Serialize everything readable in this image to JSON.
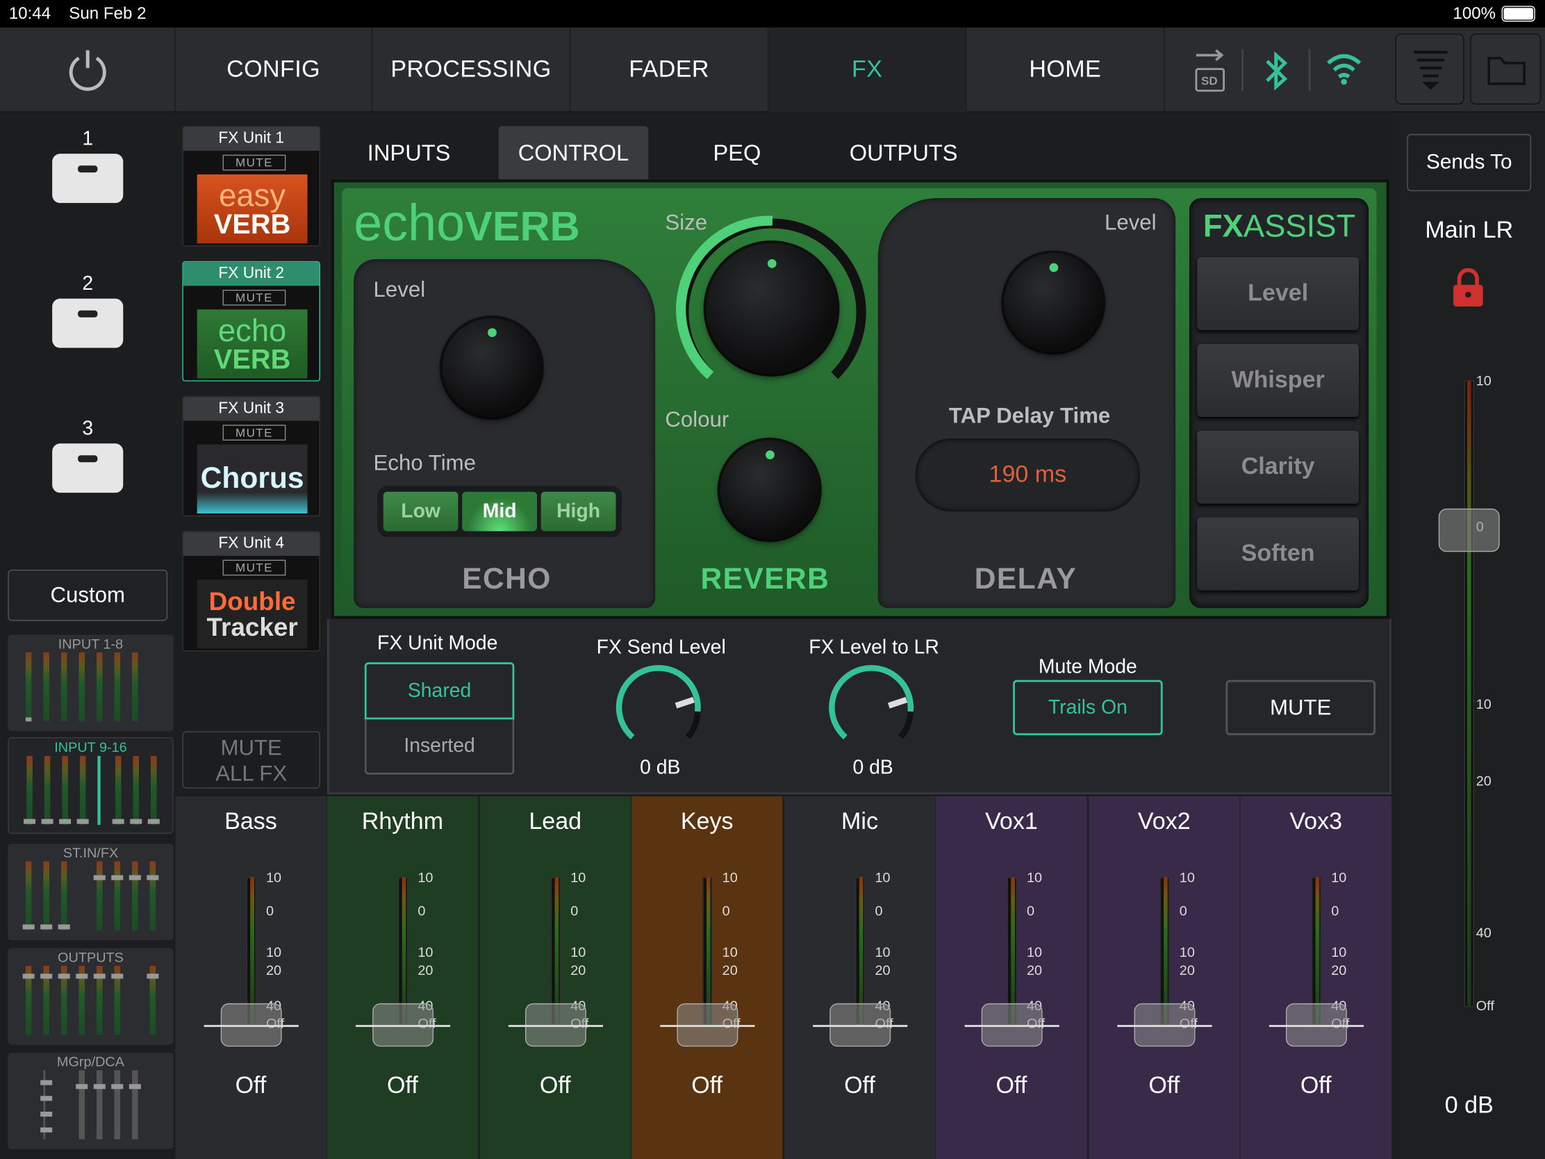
{
  "status": {
    "time": "10:44",
    "date": "Sun Feb 2",
    "battery": "100%"
  },
  "nav": {
    "tabs": [
      "CONFIG",
      "PROCESSING",
      "FADER",
      "FX",
      "HOME"
    ],
    "active": "FX"
  },
  "dca": {
    "keys": [
      "1",
      "2",
      "3"
    ],
    "custom": "Custom"
  },
  "banks": [
    {
      "label": "INPUT 1-8"
    },
    {
      "label": "INPUT 9-16"
    },
    {
      "label": "ST.IN/FX"
    },
    {
      "label": "OUTPUTS"
    },
    {
      "label": "MGrp/DCA"
    }
  ],
  "fx_units": [
    {
      "header": "FX Unit 1",
      "mute": "MUTE",
      "art_top": "easy",
      "art_bottom": "VERB"
    },
    {
      "header": "FX Unit 2",
      "mute": "MUTE",
      "art_top": "echo",
      "art_bottom": "VERB"
    },
    {
      "header": "FX Unit 3",
      "mute": "MUTE",
      "art_top": "Chorus",
      "art_bottom": ""
    },
    {
      "header": "FX Unit 4",
      "mute": "MUTE",
      "art_top": "Double",
      "art_bottom": "Tracker"
    }
  ],
  "mute_all_fx": [
    "MUTE",
    "ALL FX"
  ],
  "fx_tabs": [
    "INPUTS",
    "CONTROL",
    "PEQ",
    "OUTPUTS"
  ],
  "active_fx_tab": "CONTROL",
  "effect": {
    "logo_a": "echo",
    "logo_b": "VERB",
    "echo": {
      "level_label": "Level",
      "time_label": "Echo Time",
      "options": [
        "Low",
        "Mid",
        "High"
      ],
      "selected": "Mid",
      "title": "ECHO"
    },
    "reverb": {
      "size_label": "Size",
      "colour_label": "Colour",
      "title": "REVERB"
    },
    "delay": {
      "level_label": "Level",
      "tap_label": "TAP Delay Time",
      "tap_value": "190 ms",
      "title": "DELAY"
    },
    "assist": {
      "logo_a": "FX",
      "logo_b": "ASSIST",
      "buttons": [
        "Level",
        "Whisper",
        "Clarity",
        "Soften"
      ]
    }
  },
  "controls": {
    "unit_mode_label": "FX Unit Mode",
    "unit_mode_options": [
      "Shared",
      "Inserted"
    ],
    "unit_mode_selected": "Shared",
    "send_level_label": "FX Send Level",
    "send_level_value": "0 dB",
    "level_to_lr_label": "FX Level to LR",
    "level_to_lr_value": "0 dB",
    "mute_mode_label": "Mute Mode",
    "mute_mode_value": "Trails On",
    "mute_label": "MUTE"
  },
  "channels": [
    {
      "name": "Bass",
      "value": "Off",
      "color": "#2a2b2e"
    },
    {
      "name": "Rhythm",
      "value": "Off",
      "color": "#1f3d22"
    },
    {
      "name": "Lead",
      "value": "Off",
      "color": "#1f3d22"
    },
    {
      "name": "Keys",
      "value": "Off",
      "color": "#5a3410"
    },
    {
      "name": "Mic",
      "value": "Off",
      "color": "#2a2b2e"
    },
    {
      "name": "Vox1",
      "value": "Off",
      "color": "#3a2a4a"
    },
    {
      "name": "Vox2",
      "value": "Off",
      "color": "#3a2a4a"
    },
    {
      "name": "Vox3",
      "value": "Off",
      "color": "#3a2a4a"
    }
  ],
  "strip_scale": [
    "10",
    "0",
    "10",
    "20",
    "40",
    "Off"
  ],
  "right": {
    "sends_to": "Sends To",
    "bus": "Main LR",
    "value": "0 dB",
    "scale": [
      "10",
      "0",
      "10",
      "20",
      "40",
      "Off"
    ]
  },
  "colors": {
    "accent": "#35c29b",
    "tap": "#e0603a"
  }
}
